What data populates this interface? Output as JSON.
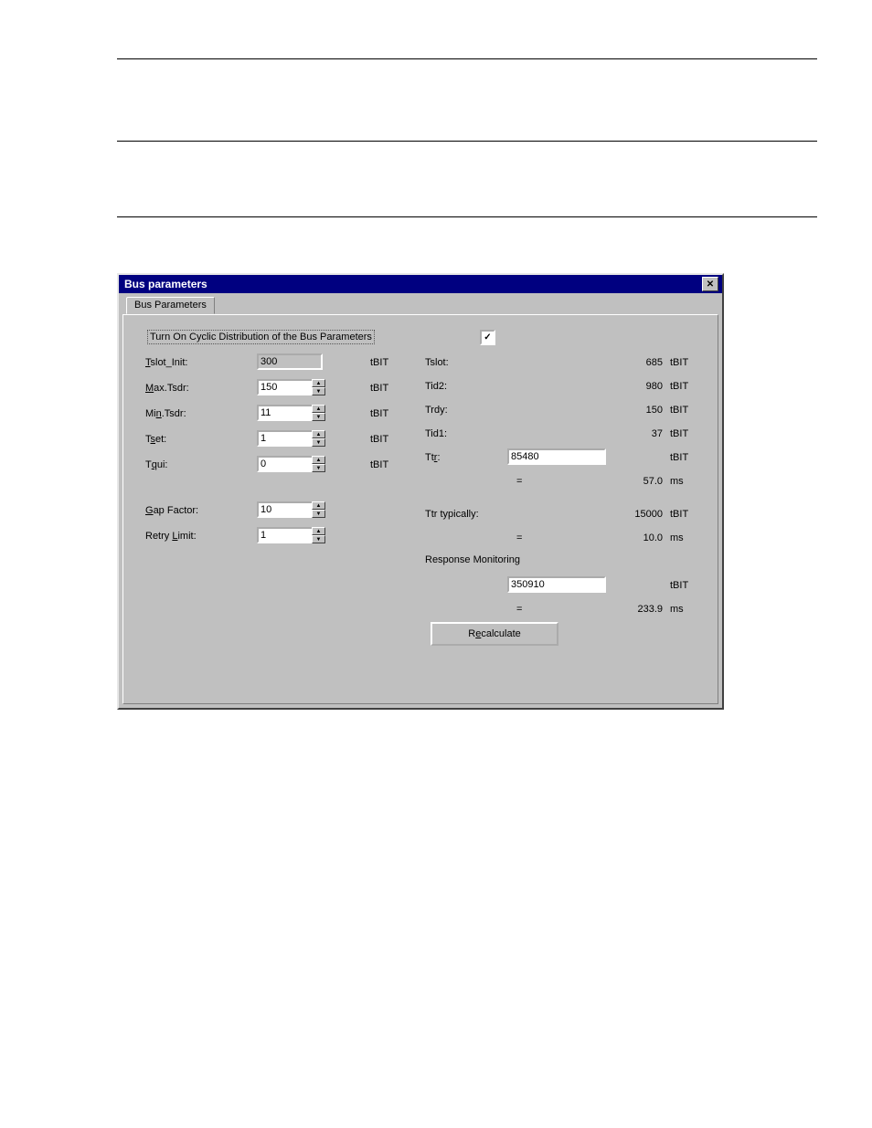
{
  "dialog": {
    "title": "Bus parameters",
    "tab": "Bus Parameters",
    "cyclic_label": "Turn On Cyclic Distribution of the Bus Parameters"
  },
  "units": {
    "tbit": "tBIT",
    "ms": "ms"
  },
  "misc": {
    "eq": "="
  },
  "left": {
    "tslot_init": {
      "u": "T",
      "rest": "slot_Init:",
      "value": "300"
    },
    "max_tsdr": {
      "u": "M",
      "rest": "ax.Tsdr:",
      "value": "150"
    },
    "min_tsdr": {
      "pre": "Mi",
      "u": "n",
      "rest": ".Tsdr:",
      "value": "11"
    },
    "tset": {
      "pre": "T",
      "u": "s",
      "rest": "et:",
      "value": "1"
    },
    "tqui": {
      "pre": "T",
      "u": "q",
      "rest": "ui:",
      "value": "0"
    },
    "gap": {
      "u": "G",
      "rest": "ap Factor:",
      "value": "10"
    },
    "retry": {
      "pre": "Retry ",
      "u": "L",
      "rest": "imit:",
      "value": "1"
    }
  },
  "right": {
    "tslot": {
      "label": "Tslot:",
      "value": "685"
    },
    "tid2": {
      "label": "Tid2:",
      "value": "980"
    },
    "trdy": {
      "label": "Trdy:",
      "value": "150"
    },
    "tid1": {
      "label": "Tid1:",
      "value": "37"
    },
    "ttr": {
      "pre": "Tt",
      "u": "r",
      "rest": ":",
      "value": "85480"
    },
    "ttr_ms": "57.0",
    "ttr_typ": {
      "label": "Ttr typically:",
      "value": "15000"
    },
    "ttr_typ_ms": "10.0",
    "resp_mon_label": "Response Monitoring",
    "resp_mon_value": "350910",
    "resp_mon_ms": "233.9",
    "recalc": {
      "pre": "R",
      "u": "e",
      "rest": "calculate"
    }
  }
}
